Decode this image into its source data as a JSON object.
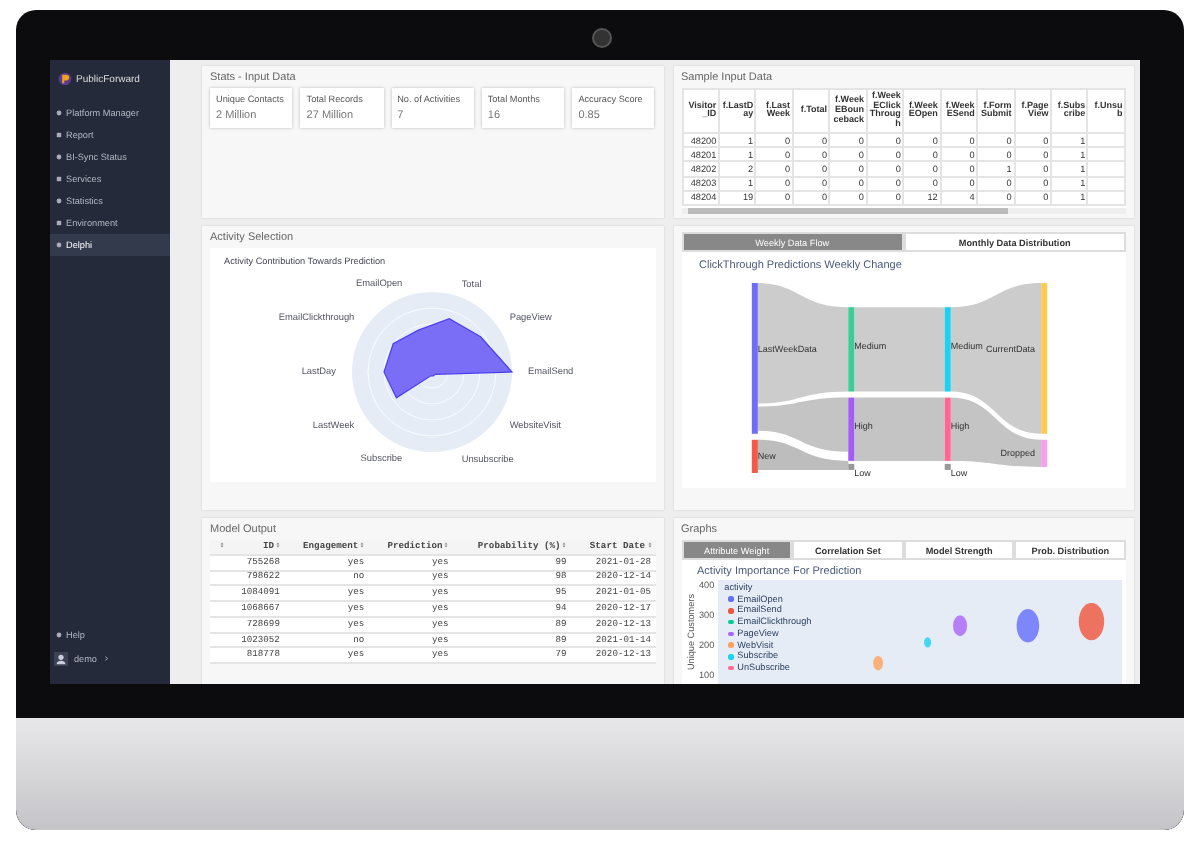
{
  "sidebar": {
    "brand": "PublicForward",
    "items": [
      {
        "label": "Platform Manager",
        "selected": false
      },
      {
        "label": "Report",
        "selected": false
      },
      {
        "label": "BI-Sync Status",
        "selected": false
      },
      {
        "label": "Services",
        "selected": false
      },
      {
        "label": "Statistics",
        "selected": false
      },
      {
        "label": "Environment",
        "selected": false
      },
      {
        "label": "Delphi",
        "selected": true
      }
    ],
    "help": "Help",
    "user": "demo"
  },
  "stats": {
    "title": "Stats - Input Data",
    "cards": [
      {
        "label": "Unique Contacts",
        "value": "2 Million"
      },
      {
        "label": "Total Records",
        "value": "27 Million"
      },
      {
        "label": "No. of Activities",
        "value": "7"
      },
      {
        "label": "Total Months",
        "value": "16"
      },
      {
        "label": "Accuracy Score",
        "value": "0.85"
      }
    ]
  },
  "sample": {
    "title": "Sample Input Data",
    "columns": [
      "Visitor_ID",
      "f.LastDay",
      "f.LastWeek",
      "f.Total",
      "f.WeekEBounceback",
      "f.WeekEClickThrough",
      "f.WeekEOpen",
      "f.WeekESend",
      "f.FormSubmit",
      "f.PageView",
      "f.Subscribe",
      "f.Unsub"
    ],
    "rows": [
      [
        "48200",
        "1",
        "0",
        "0",
        "0",
        "0",
        "0",
        "0",
        "0",
        "0",
        "1",
        ""
      ],
      [
        "48201",
        "1",
        "0",
        "0",
        "0",
        "0",
        "0",
        "0",
        "0",
        "0",
        "1",
        ""
      ],
      [
        "48202",
        "2",
        "0",
        "0",
        "0",
        "0",
        "0",
        "0",
        "1",
        "0",
        "1",
        ""
      ],
      [
        "48203",
        "1",
        "0",
        "0",
        "0",
        "0",
        "0",
        "0",
        "0",
        "0",
        "1",
        ""
      ],
      [
        "48204",
        "19",
        "0",
        "0",
        "0",
        "0",
        "12",
        "4",
        "0",
        "0",
        "1",
        ""
      ]
    ]
  },
  "activity": {
    "title": "Activity Selection",
    "chart_title": "Activity Contribution Towards Prediction",
    "labels": [
      "EmailOpen",
      "Total",
      "EmailClickthrough",
      "PageView",
      "LastDay",
      "EmailSend",
      "LastWeek",
      "WebsiteVisit",
      "Subscribe",
      "Unsubscribe"
    ]
  },
  "flow": {
    "tabs": [
      {
        "label": "Weekly Data Flow",
        "selected": true
      },
      {
        "label": "Monthly Data Distribution",
        "selected": false
      }
    ],
    "chart_title": "ClickThrough Predictions Weekly Change",
    "nodes": [
      "LastWeekData",
      "New",
      "Medium",
      "High",
      "Low",
      "Medium",
      "High",
      "Low",
      "CurrentData",
      "Dropped"
    ]
  },
  "model": {
    "title": "Model Output",
    "columns": [
      "",
      "ID",
      "Engagement",
      "Prediction",
      "Probability (%)",
      "Start Date"
    ],
    "rows": [
      [
        "",
        "755268",
        "yes",
        "yes",
        "99",
        "2021-01-28"
      ],
      [
        "",
        "798622",
        "no",
        "yes",
        "98",
        "2020-12-14"
      ],
      [
        "",
        "1084091",
        "yes",
        "yes",
        "95",
        "2021-01-05"
      ],
      [
        "",
        "1068667",
        "yes",
        "yes",
        "94",
        "2020-12-17"
      ],
      [
        "",
        "728699",
        "yes",
        "yes",
        "89",
        "2020-12-13"
      ],
      [
        "",
        "1023052",
        "no",
        "yes",
        "89",
        "2021-01-14"
      ],
      [
        "",
        "818778",
        "yes",
        "yes",
        "79",
        "2020-12-13"
      ]
    ]
  },
  "graphs": {
    "title": "Graphs",
    "tabs": [
      {
        "label": "Attribute Weight",
        "selected": true
      },
      {
        "label": "Correlation Set",
        "selected": false
      },
      {
        "label": "Model Strength",
        "selected": false
      },
      {
        "label": "Prob. Distribution",
        "selected": false
      }
    ],
    "chart_title": "Activity Importance For Prediction",
    "ylabel": "Unique Customers",
    "yticks": [
      "400",
      "300",
      "200",
      "100"
    ],
    "legend_title": "activity",
    "legend": [
      {
        "label": "EmailOpen",
        "color": "#636efa"
      },
      {
        "label": "EmailSend",
        "color": "#ef553b"
      },
      {
        "label": "EmailClickthrough",
        "color": "#00cc96"
      },
      {
        "label": "PageView",
        "color": "#ab63fa"
      },
      {
        "label": "WebVisit",
        "color": "#ffa15a"
      },
      {
        "label": "Subscribe",
        "color": "#19d3f3"
      },
      {
        "label": "UnSubscribe",
        "color": "#ff6692"
      }
    ]
  }
}
